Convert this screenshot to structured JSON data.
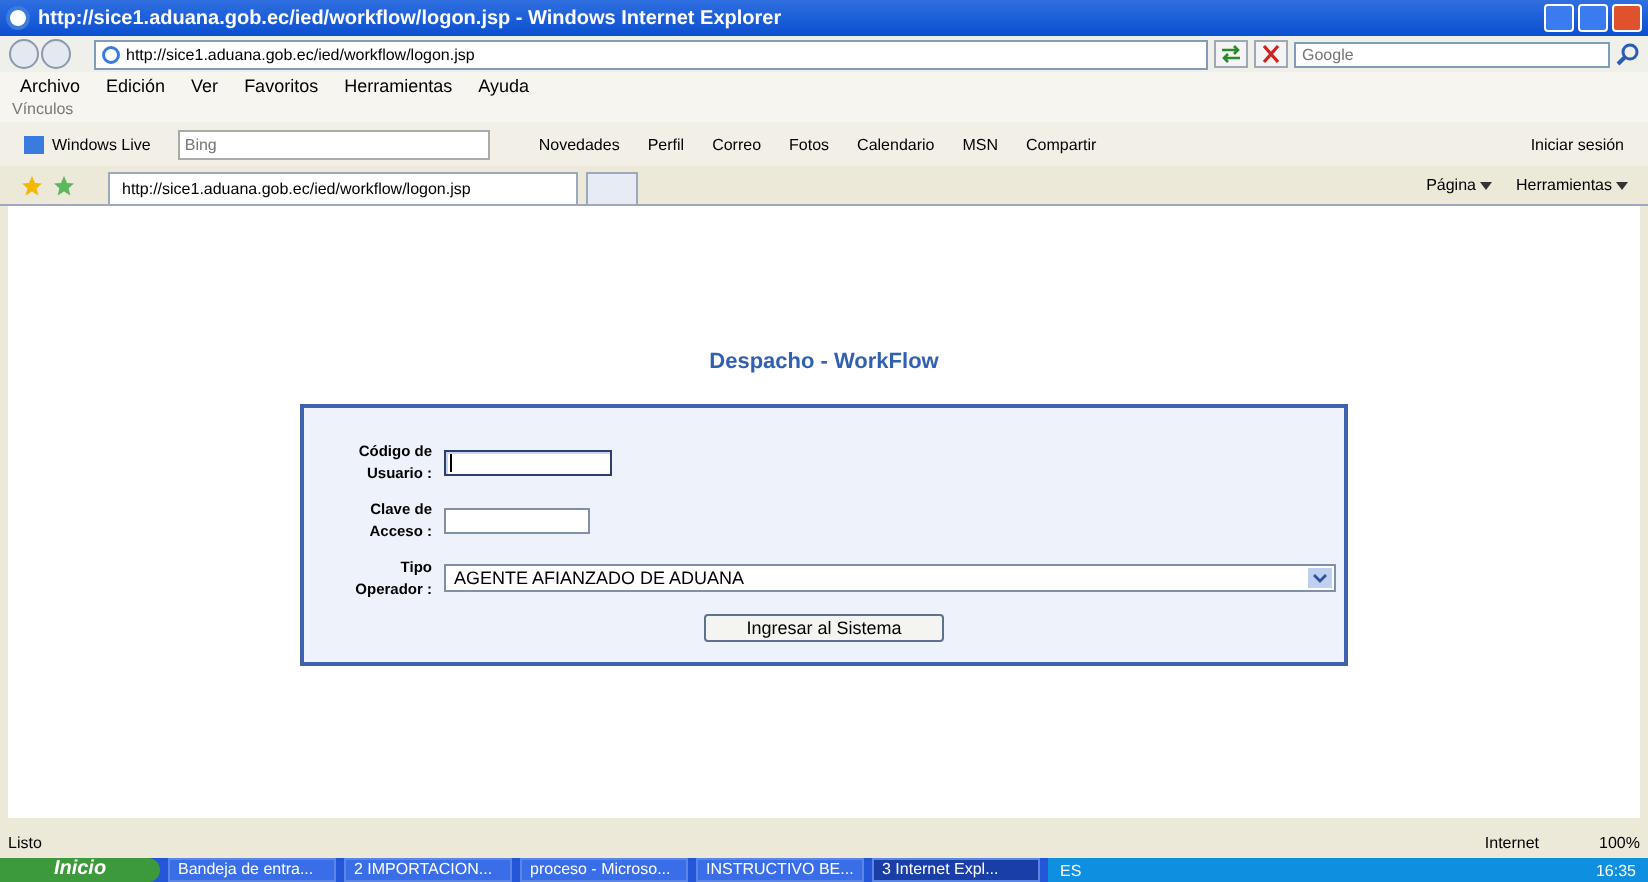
{
  "window": {
    "title": "http://sice1.aduana.gob.ec/ied/workflow/logon.jsp - Windows Internet Explorer"
  },
  "address_bar": {
    "url": "http://sice1.aduana.gob.ec/ied/workflow/logon.jsp",
    "search_placeholder": "Google"
  },
  "menu": [
    "Archivo",
    "Edición",
    "Ver",
    "Favoritos",
    "Herramientas",
    "Ayuda"
  ],
  "links_label": "Vínculos",
  "links_bar": {
    "brand": "Windows Live",
    "search_placeholder": "Bing",
    "items": [
      "Novedades",
      "Perfil",
      "Correo",
      "Fotos",
      "Calendario",
      "MSN",
      "Compartir"
    ],
    "sign_in": "Iniciar sesión"
  },
  "tabs": [
    {
      "label": "http://sice1.aduana.gob.ec/ied/workflow/logon.jsp",
      "selected": true
    },
    {
      "selected": false
    }
  ],
  "command_bar": {
    "page": "Página",
    "tools": "Herramientas"
  },
  "page": {
    "heading": "Despacho - WorkFlow",
    "fields": [
      {
        "kind": "text",
        "label": "Código de\nUsuario :",
        "focused": true
      },
      {
        "kind": "password",
        "label": "Clave de\nAcceso :",
        "focused": false
      },
      {
        "kind": "select",
        "label": "Tipo\nOperador :",
        "value": "AGENTE AFIANZADO DE ADUANA"
      }
    ],
    "submit": "Ingresar al Sistema"
  },
  "status_bar": {
    "text": "Listo",
    "zone": "Internet",
    "zoom": "100%"
  },
  "taskbar": {
    "start": "Inicio",
    "tasks": [
      {
        "label": "Bandeja de entra...",
        "selected": false
      },
      {
        "label": "2 IMPORTACION...",
        "selected": false
      },
      {
        "label": "proceso - Microso...",
        "selected": false
      },
      {
        "label": "INSTRUCTIVO BE...",
        "selected": false
      },
      {
        "label": "3 Internet Expl...",
        "selected": true
      }
    ],
    "language": "ES",
    "clock": "16:35"
  }
}
